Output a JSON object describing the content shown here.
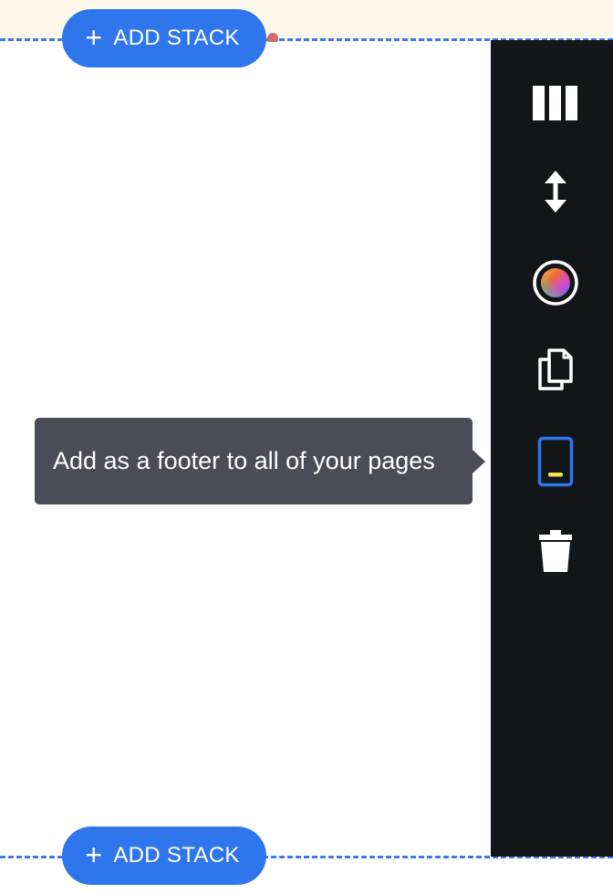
{
  "top_add_stack": {
    "label": "ADD STACK"
  },
  "bottom_add_stack": {
    "label": "ADD STACK"
  },
  "tooltip": {
    "text": "Add as a footer to all of your pages"
  },
  "toolbar": {
    "tools": [
      {
        "icon": "columns-icon"
      },
      {
        "icon": "vertical-resize-icon"
      },
      {
        "icon": "color-wheel-icon"
      },
      {
        "icon": "duplicate-icon"
      },
      {
        "icon": "footer-icon"
      },
      {
        "icon": "trash-icon"
      }
    ]
  },
  "colors": {
    "accent_blue": "#2f76ec",
    "sidebar_bg": "#131619",
    "tooltip_bg": "#4a4d57",
    "footer_marker": "#f2e34b"
  }
}
